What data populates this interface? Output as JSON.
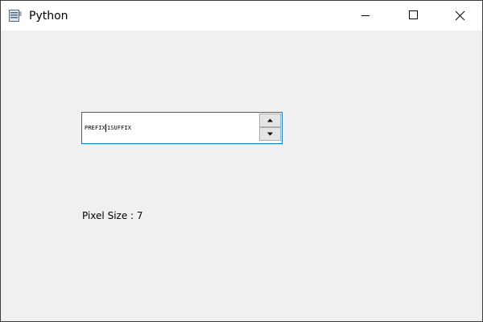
{
  "window": {
    "title": "Python",
    "app_icon": "python-app-icon",
    "controls": {
      "minimize_icon": "minimize-icon",
      "maximize_icon": "maximize-icon",
      "close_icon": "close-icon"
    }
  },
  "spinbox": {
    "prefix": "PREFIX",
    "value": "1",
    "suffix": "SUFFIX",
    "up_icon": "arrow-up-icon",
    "down_icon": "arrow-down-icon",
    "focus_color": "#0078d7"
  },
  "label": {
    "text": "Pixel Size : 7"
  }
}
